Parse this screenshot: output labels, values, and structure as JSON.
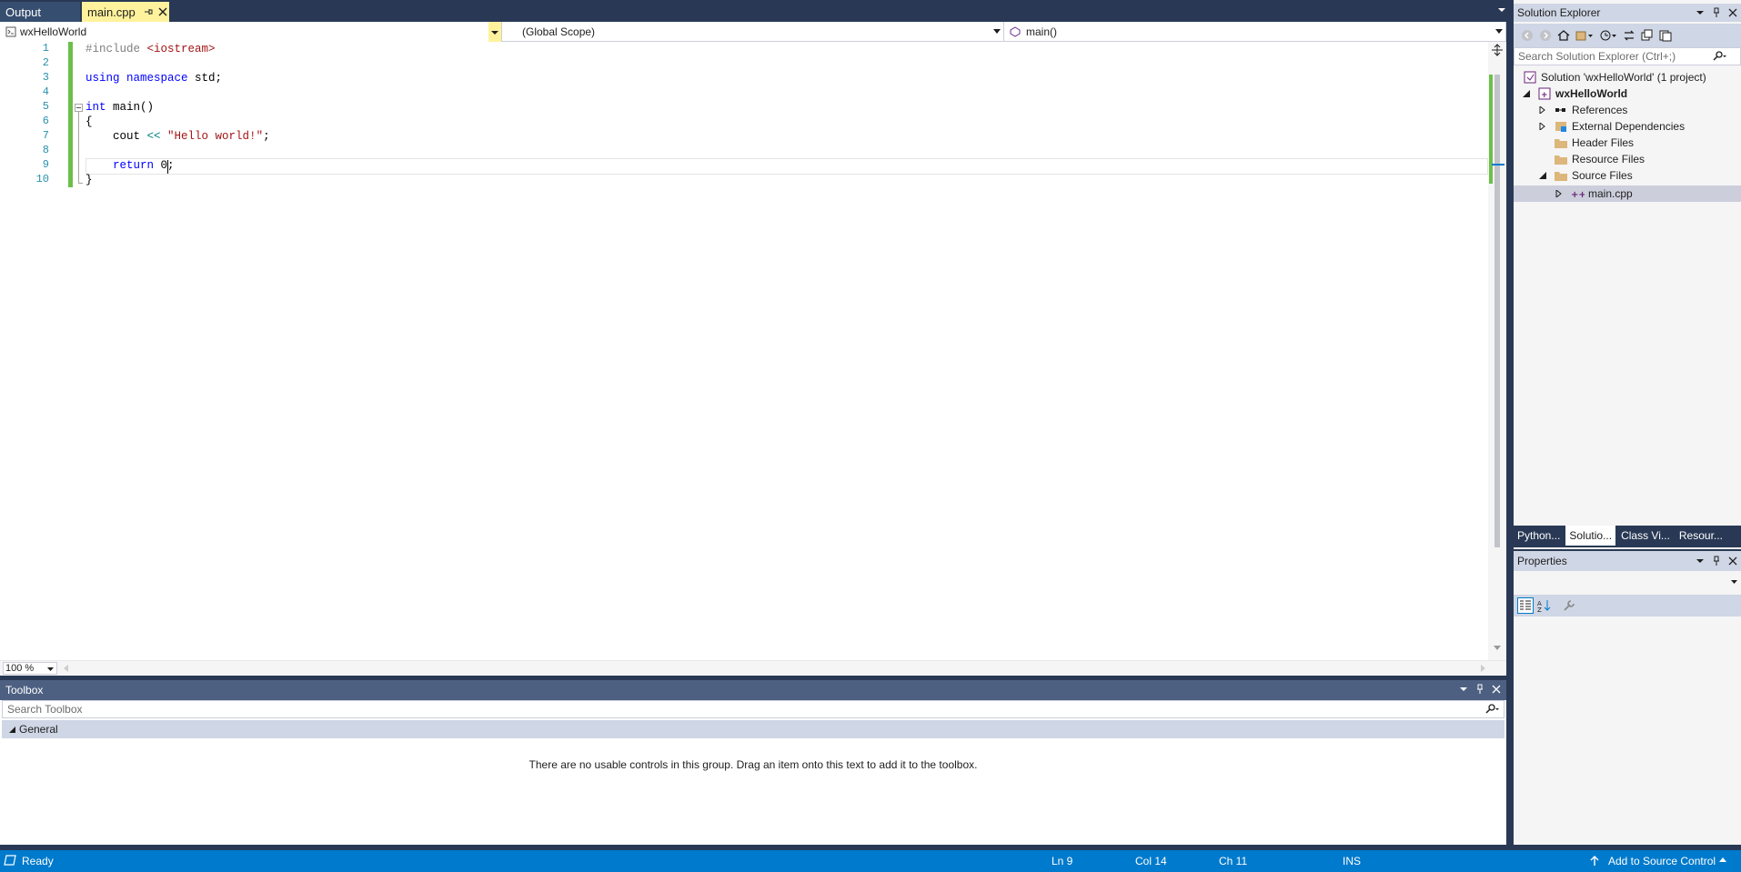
{
  "tabs": {
    "output": "Output",
    "main": "main.cpp"
  },
  "nav": {
    "project": "wxHelloWorld",
    "scope": "(Global Scope)",
    "member": "main()"
  },
  "editor": {
    "line_numbers": [
      "1",
      "2",
      "3",
      "4",
      "5",
      "6",
      "7",
      "8",
      "9",
      "10"
    ],
    "lines": [
      [
        {
          "t": "#include ",
          "c": "pp"
        },
        {
          "t": "<iostream>",
          "c": "str"
        }
      ],
      [],
      [
        {
          "t": "using ",
          "c": "kw"
        },
        {
          "t": "namespace ",
          "c": "kw"
        },
        {
          "t": "std;",
          "c": ""
        }
      ],
      [],
      [
        {
          "t": "int ",
          "c": "kw"
        },
        {
          "t": "main()",
          "c": ""
        }
      ],
      [
        {
          "t": "{",
          "c": ""
        }
      ],
      [
        {
          "t": "    cout ",
          "c": ""
        },
        {
          "t": "<<",
          "c": "op"
        },
        {
          "t": " ",
          "c": ""
        },
        {
          "t": "\"Hello world!\"",
          "c": "str"
        },
        {
          "t": ";",
          "c": ""
        }
      ],
      [],
      [
        {
          "t": "    ",
          "c": ""
        },
        {
          "t": "return ",
          "c": "kw"
        },
        {
          "t": "0;",
          "c": ""
        }
      ],
      [
        {
          "t": "}",
          "c": ""
        }
      ]
    ],
    "zoom": "100 %"
  },
  "toolbox": {
    "title": "Toolbox",
    "search_placeholder": "Search Toolbox",
    "group": "General",
    "empty_message": "There are no usable controls in this group. Drag an item onto this text to add it to the toolbox."
  },
  "solution_explorer": {
    "title": "Solution Explorer",
    "search_placeholder": "Search Solution Explorer (Ctrl+;)",
    "tree": {
      "solution": "Solution 'wxHelloWorld' (1 project)",
      "project": "wxHelloWorld",
      "references": "References",
      "external": "External Dependencies",
      "header": "Header Files",
      "resource": "Resource Files",
      "source": "Source Files",
      "main": "main.cpp"
    },
    "tabs": [
      "Python...",
      "Solutio...",
      "Class Vi...",
      "Resour..."
    ]
  },
  "properties": {
    "title": "Properties"
  },
  "status": {
    "ready": "Ready",
    "ln": "Ln 9",
    "col": "Col 14",
    "ch": "Ch 11",
    "ins": "INS",
    "source_control": "Add to Source Control"
  },
  "colors": {
    "accent": "#007acc",
    "tab_active": "#fff29d",
    "chrome": "#293955"
  }
}
